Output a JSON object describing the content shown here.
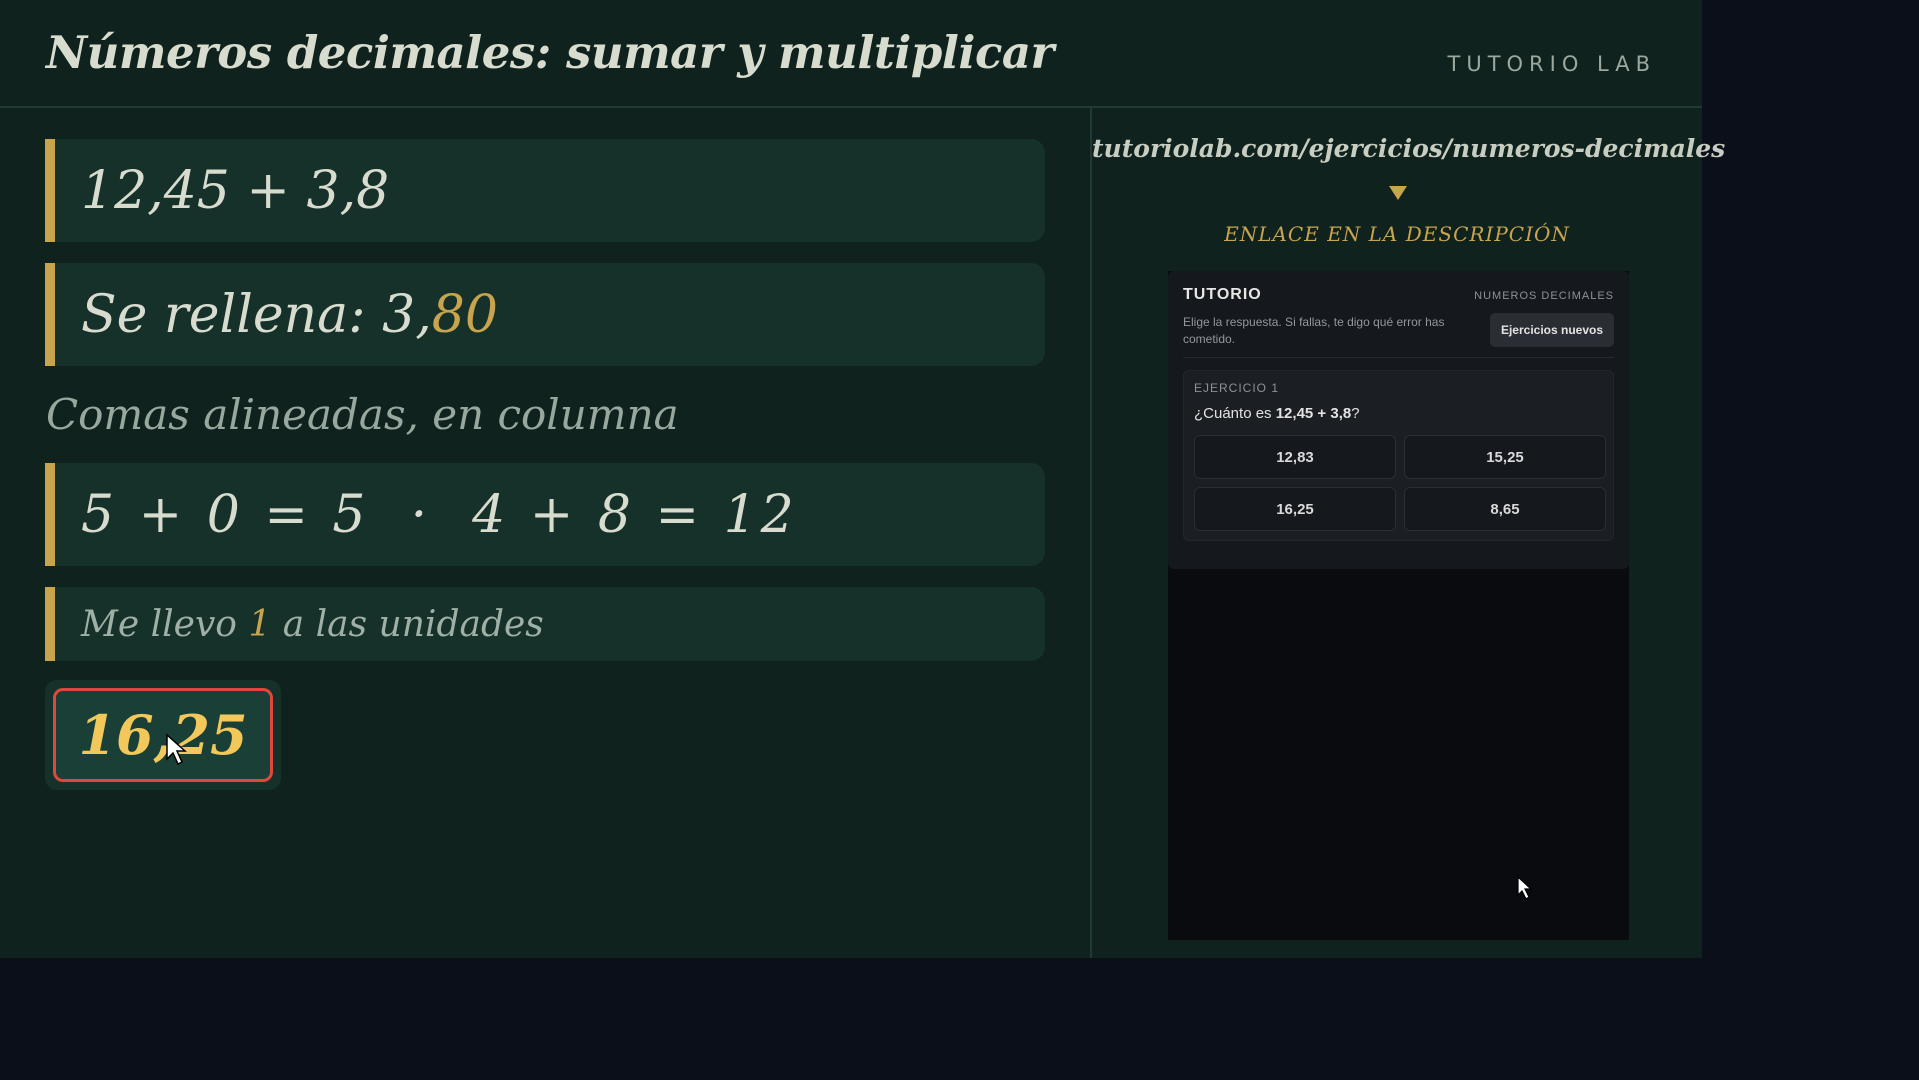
{
  "header": {
    "title": "Números decimales: sumar y multiplicar",
    "brand": "TUTORIO LAB"
  },
  "steps": {
    "problem": "12,45 + 3,8",
    "fill_prefix": "Se rellena: 3,",
    "fill_highlight": "80",
    "note": "Comas alineadas, en columna",
    "columns": "5 + 0 = 5  ·  4 + 8 = 12",
    "carry_prefix": "Me llevo ",
    "carry_highlight": "1",
    "carry_suffix": " a las unidades",
    "answer": "16,25"
  },
  "right_panel": {
    "url": "tutoriolab.com/ejercicios/numeros-decimales",
    "link_label": "ENLACE EN LA DESCRIPCIÓN"
  },
  "widget": {
    "title": "TUTORIO",
    "topic": "NUMEROS DECIMALES",
    "description": "Elige la respuesta. Si fallas, te digo qué error has cometido.",
    "new_button": "Ejercicios nuevos",
    "exercise_label": "EJERCICIO 1",
    "question_prefix": "¿Cuánto es ",
    "question_bold": "12,45 + 3,8",
    "question_suffix": "?",
    "options": [
      "12,83",
      "15,25",
      "16,25",
      "8,65"
    ]
  },
  "colors": {
    "board": "#0f221d",
    "accent_gold": "#c9a44e",
    "answer_border": "#e0473d",
    "answer_text": "#f2c85b"
  }
}
